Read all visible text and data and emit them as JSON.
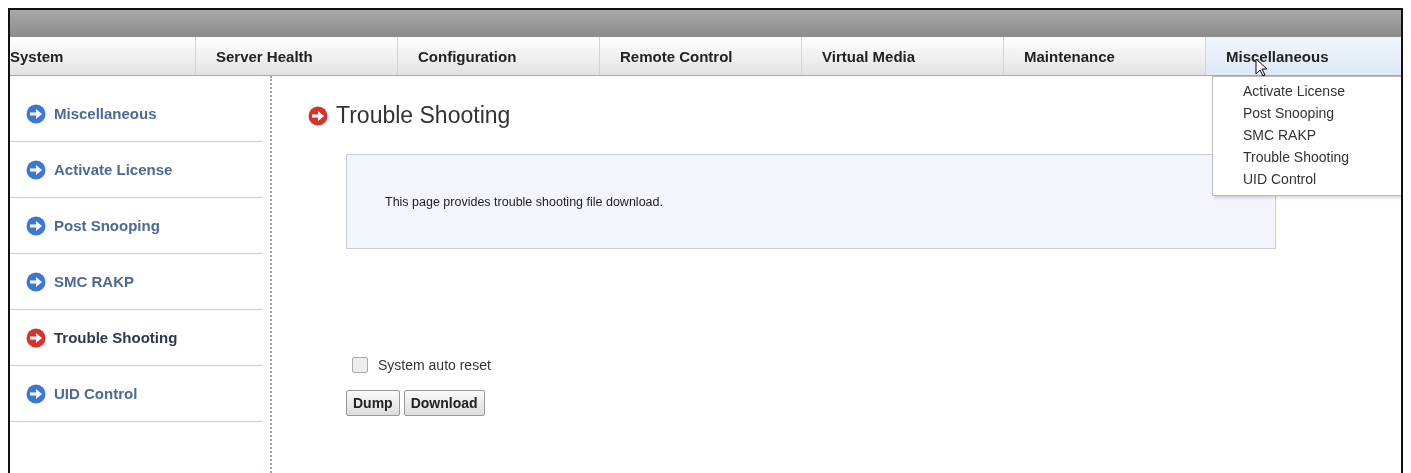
{
  "tabs": [
    {
      "label": "System",
      "selected": false
    },
    {
      "label": "Server Health",
      "selected": false
    },
    {
      "label": "Configuration",
      "selected": false
    },
    {
      "label": "Remote Control",
      "selected": false
    },
    {
      "label": "Virtual Media",
      "selected": false
    },
    {
      "label": "Maintenance",
      "selected": false
    },
    {
      "label": "Miscellaneous",
      "selected": true
    }
  ],
  "dropdown": {
    "items": [
      "Activate License",
      "Post Snooping",
      "SMC RAKP",
      "Trouble Shooting",
      "UID Control"
    ]
  },
  "sidebar": {
    "items": [
      {
        "label": "Miscellaneous",
        "selected": false
      },
      {
        "label": "Activate License",
        "selected": false
      },
      {
        "label": "Post Snooping",
        "selected": false
      },
      {
        "label": "SMC RAKP",
        "selected": false
      },
      {
        "label": "Trouble Shooting",
        "selected": true
      },
      {
        "label": "UID Control",
        "selected": false
      }
    ]
  },
  "page": {
    "title": "Trouble Shooting",
    "description": "This page provides trouble shooting file download.",
    "auto_reset": {
      "label": "System auto reset",
      "checked": false
    },
    "buttons": [
      "Dump",
      "Download"
    ]
  }
}
